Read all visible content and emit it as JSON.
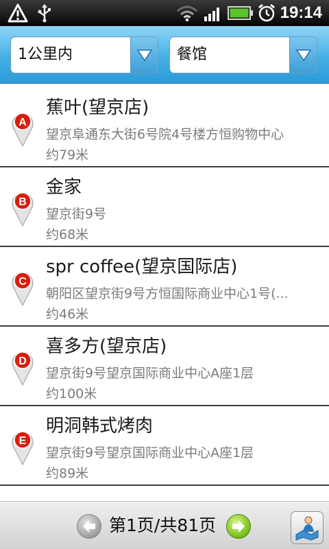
{
  "status_bar": {
    "time": "19:14",
    "icons": [
      "warning-icon",
      "usb-icon",
      "wifi-icon",
      "signal-icon",
      "battery-icon",
      "alarm-icon"
    ]
  },
  "filters": {
    "distance": {
      "value": "1公里内"
    },
    "category": {
      "value": "餐馆"
    }
  },
  "results": [
    {
      "marker": "A",
      "name": "蕉叶(望京店)",
      "address": "望京阜通东大街6号院4号楼方恒购物中心",
      "distance": "约79米"
    },
    {
      "marker": "B",
      "name": "金家",
      "address": "望京街9号",
      "distance": "约68米"
    },
    {
      "marker": "C",
      "name": "spr coffee(望京国际店)",
      "address": "朝阳区望京街9号方恒国际商业中心1号(...",
      "distance": "约46米"
    },
    {
      "marker": "D",
      "name": "喜多方(望京店)",
      "address": "望京街9号望京国际商业中心A座1层",
      "distance": "约100米"
    },
    {
      "marker": "E",
      "name": "明洞韩式烤肉",
      "address": "望京街9号望京国际商业中心A座1层",
      "distance": "约89米"
    }
  ],
  "pagination": {
    "label": "第1页/共81页",
    "prev_icon": "arrow-left-icon",
    "next_icon": "arrow-right-icon"
  },
  "map_button": {
    "icon": "map-person-icon"
  },
  "colors": {
    "header_blue": "#45b0e6",
    "marker_red": "#d81e0e",
    "next_green": "#7cc11e",
    "divider": "#3c3c3c"
  }
}
